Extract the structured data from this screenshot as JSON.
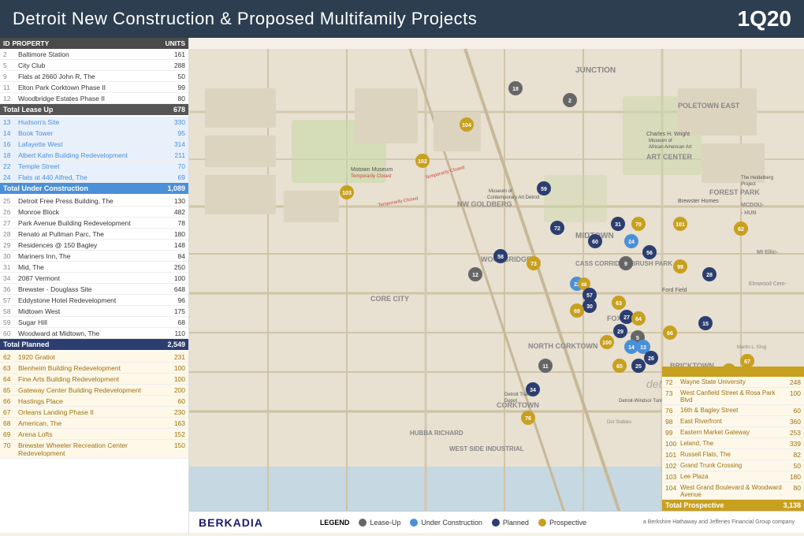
{
  "header": {
    "title": "Detroit New Construction & Proposed Multifamily Projects",
    "quarter": "1Q20"
  },
  "legend": {
    "label": "LEGEND",
    "items": [
      {
        "label": "Lease-Up",
        "color": "#666"
      },
      {
        "label": "Under Construction",
        "color": "#4a90d9"
      },
      {
        "label": "Planned",
        "color": "#2c3e70"
      },
      {
        "label": "Prospective",
        "color": "#c8a020"
      }
    ]
  },
  "attribution": "a Berkshire Hathaway and Jefferies Financial Group company",
  "sections": [
    {
      "name": "Lease Up",
      "color": "#555",
      "pin_color": "lease-up",
      "properties": [
        {
          "id": "2",
          "name": "Baltimore Station",
          "units": "161"
        },
        {
          "id": "5",
          "name": "City Club",
          "units": "288"
        },
        {
          "id": "9",
          "name": "Flats at 2660 John R, The",
          "units": "50"
        },
        {
          "id": "11",
          "name": "Elton Park Corktown Phase II",
          "units": "99"
        },
        {
          "id": "12",
          "name": "Woodbridge Estates Phase II",
          "units": "80"
        }
      ],
      "total_label": "Total Lease Up",
      "total": "678"
    },
    {
      "name": "Under Construction",
      "color": "#4a90d9",
      "pin_color": "construction",
      "properties": [
        {
          "id": "13",
          "name": "Hudson's Site",
          "units": "330"
        },
        {
          "id": "14",
          "name": "Book Tower",
          "units": "95"
        },
        {
          "id": "16",
          "name": "Lafayette West",
          "units": "314"
        },
        {
          "id": "18",
          "name": "Albert Kahn Building Redevelopment",
          "units": "211"
        },
        {
          "id": "22",
          "name": "Temple Street",
          "units": "70"
        },
        {
          "id": "24",
          "name": "Flats at 440 Alfred, The",
          "units": "69"
        }
      ],
      "total_label": "Total Under Construction",
      "total": "1,089"
    },
    {
      "name": "Planned",
      "color": "#2c3e70",
      "pin_color": "planned",
      "properties": [
        {
          "id": "25",
          "name": "Detroit Free Press Building, The",
          "units": "130"
        },
        {
          "id": "26",
          "name": "Monroe Block",
          "units": "482"
        },
        {
          "id": "27",
          "name": "Park Avenue Building Redevelopment",
          "units": "78"
        },
        {
          "id": "28",
          "name": "Renato at Pullman Parc, The",
          "units": "180"
        },
        {
          "id": "29",
          "name": "Residences @ 150 Bagley",
          "units": "148"
        },
        {
          "id": "30",
          "name": "Mariners Inn, The",
          "units": "84"
        },
        {
          "id": "31",
          "name": "Mid, The",
          "units": "250"
        },
        {
          "id": "34",
          "name": "2087 Vermont",
          "units": "100"
        },
        {
          "id": "36",
          "name": "Brewster - Douglass Site",
          "units": "648"
        },
        {
          "id": "57",
          "name": "Eddystone Hotel Redevelopment",
          "units": "96"
        },
        {
          "id": "58",
          "name": "Midtown West",
          "units": "175"
        },
        {
          "id": "59",
          "name": "Sugar Hill",
          "units": "68"
        },
        {
          "id": "60",
          "name": "Woodward at Midtown, The",
          "units": "110"
        }
      ],
      "total_label": "Total Planned",
      "total": "2,549"
    },
    {
      "name": "Prospective",
      "color": "#c8a020",
      "pin_color": "prospective",
      "properties": [
        {
          "id": "62",
          "name": "1920 Gratiot",
          "units": "231"
        },
        {
          "id": "63",
          "name": "Blenheim Building Redevelopment",
          "units": "100"
        },
        {
          "id": "64",
          "name": "Fine Arts Building Redevelopment",
          "units": "100"
        },
        {
          "id": "65",
          "name": "Gateway Center Building Redevelopment",
          "units": "200"
        },
        {
          "id": "66",
          "name": "Hastings Place",
          "units": "60"
        },
        {
          "id": "67",
          "name": "Orleans Landing Phase II",
          "units": "230"
        },
        {
          "id": "68",
          "name": "American, The",
          "units": "163"
        },
        {
          "id": "69",
          "name": "Arena Lofts",
          "units": "152"
        },
        {
          "id": "70",
          "name": "Brewster Wheeler Recreation Center Redevelopment",
          "units": "150"
        },
        {
          "id": "72",
          "name": "Wayne State University",
          "units": "248"
        },
        {
          "id": "73",
          "name": "West Canfield Street & Rosa Park Blvd",
          "units": "100"
        },
        {
          "id": "76",
          "name": "16th & Bagley Street",
          "units": "60"
        },
        {
          "id": "98",
          "name": "East Riverfront",
          "units": "360"
        },
        {
          "id": "99",
          "name": "Eastern Market Gateway",
          "units": "253"
        },
        {
          "id": "100",
          "name": "Leland, The",
          "units": "339"
        },
        {
          "id": "101",
          "name": "Russell Flats, The",
          "units": "82"
        },
        {
          "id": "102",
          "name": "Grand Trunk Crossing",
          "units": "50"
        },
        {
          "id": "103",
          "name": "Lee Plaza",
          "units": "180"
        },
        {
          "id": "104",
          "name": "West Grand Boulevard & Woodward Avenue",
          "units": "80"
        }
      ],
      "total_label": "Total Prospective",
      "total": "3,138"
    }
  ],
  "map_pins": [
    {
      "id": "18",
      "type": "construction",
      "x_pct": 53,
      "y_pct": 8
    },
    {
      "id": "2",
      "type": "lease-up",
      "x_pct": 62,
      "y_pct": 11
    },
    {
      "id": "104",
      "type": "prospective",
      "x_pct": 45,
      "y_pct": 16
    },
    {
      "id": "102",
      "type": "prospective",
      "x_pct": 38,
      "y_pct": 24
    },
    {
      "id": "103",
      "type": "prospective",
      "x_pct": 26,
      "y_pct": 30
    },
    {
      "id": "59",
      "type": "planned",
      "x_pct": 58,
      "y_pct": 30
    },
    {
      "id": "72",
      "type": "planned",
      "x_pct": 60,
      "y_pct": 38
    },
    {
      "id": "73",
      "type": "prospective",
      "x_pct": 56,
      "y_pct": 45
    },
    {
      "id": "58",
      "type": "planned",
      "x_pct": 51,
      "y_pct": 44
    },
    {
      "id": "12",
      "type": "lease-up",
      "x_pct": 47,
      "y_pct": 48
    },
    {
      "id": "31",
      "type": "planned",
      "x_pct": 70,
      "y_pct": 37
    },
    {
      "id": "60",
      "type": "planned",
      "x_pct": 66,
      "y_pct": 41
    },
    {
      "id": "24",
      "type": "construction",
      "x_pct": 72,
      "y_pct": 41
    },
    {
      "id": "9",
      "type": "lease-up",
      "x_pct": 71,
      "y_pct": 46
    },
    {
      "id": "56",
      "type": "planned",
      "x_pct": 75,
      "y_pct": 43
    },
    {
      "id": "70",
      "type": "prospective",
      "x_pct": 73,
      "y_pct": 37
    },
    {
      "id": "101",
      "type": "prospective",
      "x_pct": 79,
      "y_pct": 37
    },
    {
      "id": "22",
      "type": "construction",
      "x_pct": 63,
      "y_pct": 50
    },
    {
      "id": "68",
      "type": "prospective",
      "x_pct": 64,
      "y_pct": 50
    },
    {
      "id": "57",
      "type": "planned",
      "x_pct": 65,
      "y_pct": 52
    },
    {
      "id": "30",
      "type": "planned",
      "x_pct": 65,
      "y_pct": 54
    },
    {
      "id": "69",
      "type": "prospective",
      "x_pct": 63,
      "y_pct": 55
    },
    {
      "id": "63",
      "type": "prospective",
      "x_pct": 70,
      "y_pct": 54
    },
    {
      "id": "27",
      "type": "planned",
      "x_pct": 71,
      "y_pct": 57
    },
    {
      "id": "64",
      "type": "prospective",
      "x_pct": 73,
      "y_pct": 57
    },
    {
      "id": "29",
      "type": "planned",
      "x_pct": 70,
      "y_pct": 60
    },
    {
      "id": "5",
      "type": "lease-up",
      "x_pct": 73,
      "y_pct": 61
    },
    {
      "id": "100",
      "type": "prospective",
      "x_pct": 68,
      "y_pct": 62
    },
    {
      "id": "14",
      "type": "construction",
      "x_pct": 72,
      "y_pct": 63
    },
    {
      "id": "13",
      "type": "construction",
      "x_pct": 74,
      "y_pct": 63
    },
    {
      "id": "66",
      "type": "prospective",
      "x_pct": 78,
      "y_pct": 60
    },
    {
      "id": "26",
      "type": "planned",
      "x_pct": 75,
      "y_pct": 65
    },
    {
      "id": "25",
      "type": "planned",
      "x_pct": 73,
      "y_pct": 67
    },
    {
      "id": "65",
      "type": "prospective",
      "x_pct": 70,
      "y_pct": 67
    },
    {
      "id": "11",
      "type": "lease-up",
      "x_pct": 58,
      "y_pct": 67
    },
    {
      "id": "34",
      "type": "planned",
      "x_pct": 56,
      "y_pct": 72
    },
    {
      "id": "76",
      "type": "prospective",
      "x_pct": 55,
      "y_pct": 78
    },
    {
      "id": "99",
      "type": "prospective",
      "x_pct": 80,
      "y_pct": 46
    },
    {
      "id": "28",
      "type": "planned",
      "x_pct": 85,
      "y_pct": 48
    },
    {
      "id": "15",
      "type": "planned",
      "x_pct": 84,
      "y_pct": 58
    },
    {
      "id": "62",
      "type": "prospective",
      "x_pct": 90,
      "y_pct": 38
    },
    {
      "id": "98",
      "type": "prospective",
      "x_pct": 88,
      "y_pct": 68
    },
    {
      "id": "67",
      "type": "prospective",
      "x_pct": 91,
      "y_pct": 66
    }
  ],
  "map_labels": [
    {
      "text": "JUNCTION",
      "x_pct": 65,
      "y_pct": 5
    },
    {
      "text": "POLETOWN EAST",
      "x_pct": 82,
      "y_pct": 13
    },
    {
      "text": "ART CENTER",
      "x_pct": 76,
      "y_pct": 22
    },
    {
      "text": "FOREST PARK",
      "x_pct": 87,
      "y_pct": 28
    },
    {
      "text": "NW GOLDBERG",
      "x_pct": 48,
      "y_pct": 31
    },
    {
      "text": "WOODBRIDGE",
      "x_pct": 52,
      "y_pct": 42
    },
    {
      "text": "MIDTOWN",
      "x_pct": 66,
      "y_pct": 39
    },
    {
      "text": "CASS CORRIDOR BRUSH PARK",
      "x_pct": 68,
      "y_pct": 44
    },
    {
      "text": "CORE CITY",
      "x_pct": 38,
      "y_pct": 50
    },
    {
      "text": "NORTH CORKTOWN",
      "x_pct": 58,
      "y_pct": 60
    },
    {
      "text": "FOXTOWN",
      "x_pct": 72,
      "y_pct": 56
    },
    {
      "text": "BRICKTOWN",
      "x_pct": 81,
      "y_pct": 64
    },
    {
      "text": "CORKTOWN",
      "x_pct": 59,
      "y_pct": 74
    },
    {
      "text": "WEST SIDE INDUSTRIAL",
      "x_pct": 56,
      "y_pct": 84
    },
    {
      "text": "HUBBA RICHARD",
      "x_pct": 48,
      "y_pct": 84
    }
  ],
  "berkadia_label": "BERKADIA"
}
